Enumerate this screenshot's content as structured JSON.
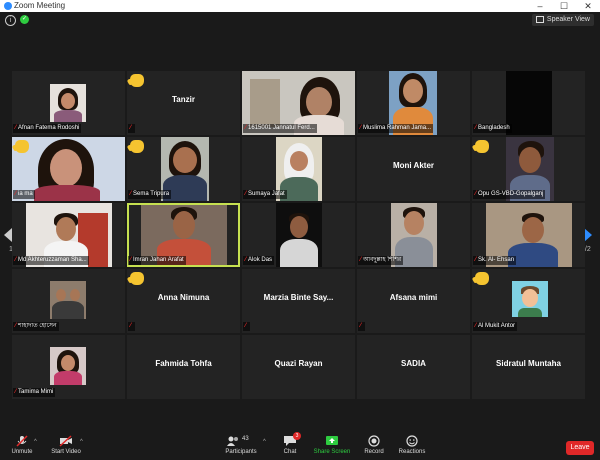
{
  "window": {
    "title": "Zoom Meeting",
    "minimize": "–",
    "maximize": "☐",
    "close": "✕"
  },
  "topbar": {
    "info": "i",
    "encryption": "✓",
    "view_button": "Speaker View"
  },
  "pager": {
    "left": "1/2",
    "right": "1/2"
  },
  "tiles": [
    {
      "label": "Afnan Fatema Rodoshi",
      "muted": true
    },
    {
      "display_name": "Tanzir",
      "hand": true,
      "muted": true
    },
    {
      "label": "1615001 Jannatul Ferd...",
      "muted": true
    },
    {
      "label": "Muslima Rahman Jama...",
      "muted": true
    },
    {
      "label": "Bangladesh",
      "muted": true
    },
    {
      "label": "ia ma",
      "hand": true,
      "muted": true
    },
    {
      "label": "Sema Tripura",
      "hand": true,
      "muted": true
    },
    {
      "label": "Sumaya Jafat",
      "muted": true
    },
    {
      "display_name": "Moni Akter",
      "muted": false
    },
    {
      "label": "Opu GS-VBD-Gopalganj",
      "hand": true,
      "muted": true
    },
    {
      "label": "Md Akhteruzzaman Sha...",
      "muted": true
    },
    {
      "label": "Imran Jahan Arafat",
      "active": true,
      "muted": true
    },
    {
      "label": "Alok Das",
      "muted": true
    },
    {
      "label": "আবদুল্লাহ শিশির",
      "muted": true
    },
    {
      "label": "Sk. Al- Ehsan",
      "muted": true
    },
    {
      "label": "শাহাদাত হোসেন",
      "muted": true
    },
    {
      "display_name": "Anna Nimuna",
      "hand": true,
      "muted": true
    },
    {
      "display_name": "Marzia Binte Say...",
      "muted": true
    },
    {
      "display_name": "Afsana mimi",
      "muted": true
    },
    {
      "label": "Al Mukit Antor",
      "hand": true,
      "muted": true
    },
    {
      "label": "Tamima Mimi",
      "muted": true
    },
    {
      "display_name": "Fahmida Tohfa",
      "muted": true
    },
    {
      "display_name": "Quazi Rayan",
      "muted": true
    },
    {
      "display_name": "SADIA",
      "muted": true
    },
    {
      "display_name": "Sidratul Muntaha",
      "muted": true
    }
  ],
  "toolbar": {
    "unmute": "Unmute",
    "start_video": "Start Video",
    "participants": "Participants",
    "participants_count": "43",
    "chat": "Chat",
    "chat_badge": "3",
    "share_screen": "Share Screen",
    "record": "Record",
    "reactions": "Reactions",
    "leave": "Leave"
  },
  "colors": {
    "active_border": "#c6e050",
    "leave": "#e02828",
    "share": "#2ecc40",
    "accent": "#2d8cff"
  }
}
